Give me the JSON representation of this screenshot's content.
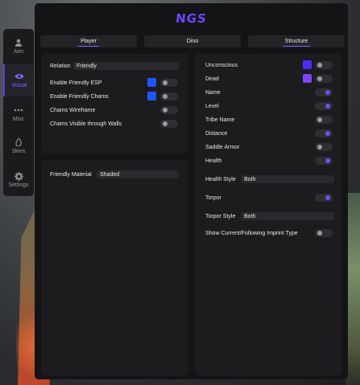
{
  "app": {
    "logo_text": "NGS"
  },
  "sidebar": {
    "items": [
      {
        "label": "Aim",
        "icon": "user-icon"
      },
      {
        "label": "Visual",
        "icon": "eye-icon",
        "active": true
      },
      {
        "label": "Misc",
        "icon": "more-dots-icon"
      },
      {
        "label": "Skins",
        "icon": "flame-icon"
      },
      {
        "label": "Settings",
        "icon": "gear-icon"
      }
    ]
  },
  "tabs": [
    {
      "label": "Player",
      "selected": true
    },
    {
      "label": "Dino"
    },
    {
      "label": "Structure"
    }
  ],
  "left_panel": {
    "relation": {
      "label": "Relation",
      "value": "Friendly"
    },
    "enable_friendly_esp": {
      "label": "Enable Friendly ESP",
      "color": "#1f55ff",
      "enabled": false
    },
    "enable_friendly_chams": {
      "label": "Enable Friendly Chams",
      "color": "#1f55ff",
      "enabled": false
    },
    "chams_wireframe": {
      "label": "Chams Wireframe",
      "enabled": false
    },
    "chams_visible_walls": {
      "label": "Chams Visible through Walls",
      "enabled": false
    },
    "friendly_material": {
      "label": "Friendly Material",
      "value": "Shaded"
    }
  },
  "right_panel": {
    "unconscious": {
      "label": "Unconscious",
      "color": "#4a2dff",
      "enabled": false
    },
    "dead": {
      "label": "Dead",
      "color": "#7b45ff",
      "enabled": false
    },
    "name": {
      "label": "Name",
      "enabled": true
    },
    "level": {
      "label": "Level",
      "enabled": true
    },
    "tribe_name": {
      "label": "Tribe Name",
      "enabled": false
    },
    "distance": {
      "label": "Distance",
      "enabled": true
    },
    "saddle_armor": {
      "label": "Saddle Armor",
      "enabled": false
    },
    "health": {
      "label": "Health",
      "enabled": true
    },
    "health_style": {
      "label": "Health Style",
      "value": "Both"
    },
    "torpor": {
      "label": "Torpor",
      "enabled": true
    },
    "torpor_style": {
      "label": "Torpor Style",
      "value": "Both"
    },
    "show_imprint_type": {
      "label": "Show Current/Following Imprint Type",
      "enabled": false
    }
  },
  "colors": {
    "accent": "#6b48ff",
    "panel": "#1c1c1f",
    "window": "#141416"
  }
}
